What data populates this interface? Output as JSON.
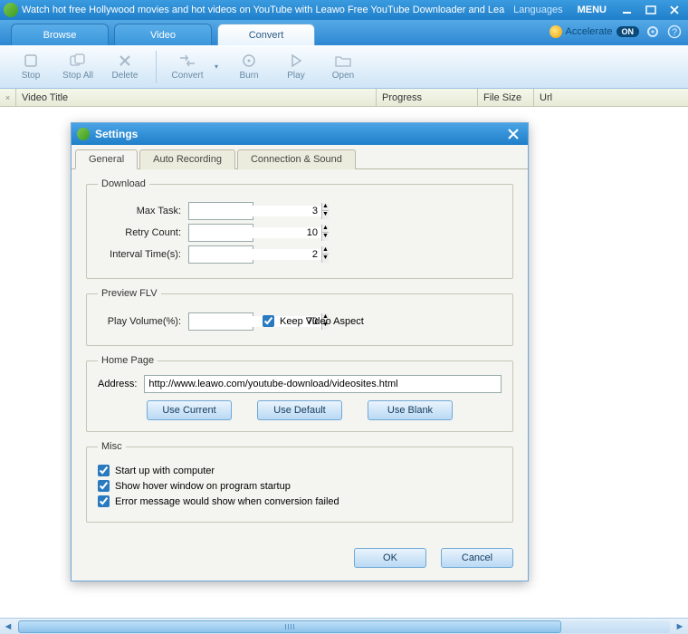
{
  "titlebar": {
    "title": "Watch hot free Hollywood movies and hot videos on YouTube with Leawo Free YouTube Downloader and Lea",
    "languages": "Languages",
    "menu": "MENU"
  },
  "tabs": {
    "browse": "Browse",
    "video": "Video",
    "convert": "Convert"
  },
  "accelerate": {
    "label": "Accelerate",
    "state": "ON"
  },
  "toolbar": {
    "stop": "Stop",
    "stop_all": "Stop All",
    "delete": "Delete",
    "convert": "Convert",
    "burn": "Burn",
    "play": "Play",
    "open": "Open"
  },
  "columns": {
    "star": "×",
    "title": "Video Title",
    "progress": "Progress",
    "size": "File Size",
    "url": "Url"
  },
  "settings": {
    "title": "Settings",
    "tabs": {
      "general": "General",
      "auto": "Auto Recording",
      "conn": "Connection & Sound"
    },
    "download": {
      "legend": "Download",
      "max_task_label": "Max Task:",
      "max_task": "3",
      "retry_label": "Retry Count:",
      "retry": "10",
      "interval_label": "Interval Time(s):",
      "interval": "2"
    },
    "preview": {
      "legend": "Preview FLV",
      "volume_label": "Play Volume(%):",
      "volume": "70",
      "keep_aspect": "Keep Video Aspect"
    },
    "homepage": {
      "legend": "Home Page",
      "address_label": "Address:",
      "address": "http://www.leawo.com/youtube-download/videosites.html",
      "use_current": "Use Current",
      "use_default": "Use Default",
      "use_blank": "Use Blank"
    },
    "misc": {
      "legend": "Misc",
      "startup": "Start up with computer",
      "hover": "Show hover window on program startup",
      "error": "Error message would show when conversion failed"
    },
    "ok": "OK",
    "cancel": "Cancel"
  }
}
